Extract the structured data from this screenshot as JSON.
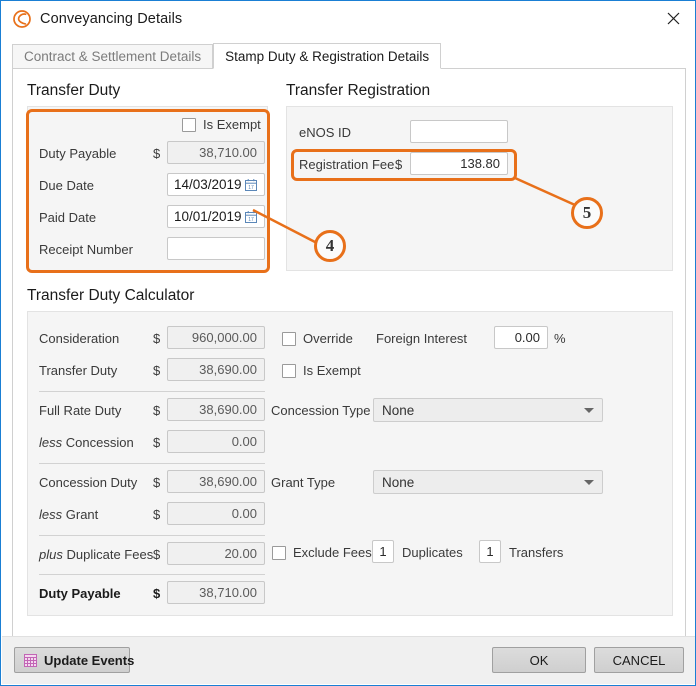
{
  "window": {
    "title": "Conveyancing Details",
    "app_icon": "conveyancing-logo-icon",
    "close_icon": "close-icon"
  },
  "tabs": [
    {
      "label": "Contract & Settlement Details",
      "active": false
    },
    {
      "label": "Stamp Duty & Registration Details",
      "active": true
    }
  ],
  "transfer_duty": {
    "title": "Transfer Duty",
    "is_exempt_label": "Is Exempt",
    "is_exempt_checked": false,
    "rows": {
      "duty_payable_label": "Duty Payable",
      "duty_payable_currency": "$",
      "duty_payable_value": "38,710.00",
      "due_date_label": "Due Date",
      "due_date_value": "14/03/2019",
      "paid_date_label": "Paid Date",
      "paid_date_value": "10/01/2019",
      "receipt_number_label": "Receipt Number",
      "receipt_number_value": ""
    }
  },
  "transfer_registration": {
    "title": "Transfer Registration",
    "enos_id_label": "eNOS ID",
    "enos_id_value": "",
    "registration_fee_label": "Registration Fee",
    "registration_fee_currency": "$",
    "registration_fee_value": "138.80"
  },
  "calculator": {
    "title": "Transfer Duty Calculator",
    "left": {
      "consideration_label": "Consideration",
      "consideration_currency": "$",
      "consideration_value": "960,000.00",
      "transfer_duty_label": "Transfer Duty",
      "transfer_duty_currency": "$",
      "transfer_duty_value": "38,690.00",
      "full_rate_duty_label": "Full Rate Duty",
      "full_rate_duty_currency": "$",
      "full_rate_duty_value": "38,690.00",
      "less_concession_prefix": "less",
      "less_concession_label": "Concession",
      "less_concession_currency": "$",
      "less_concession_value": "0.00",
      "concession_duty_label": "Concession Duty",
      "concession_duty_currency": "$",
      "concession_duty_value": "38,690.00",
      "less_grant_prefix": "less",
      "less_grant_label": "Grant",
      "less_grant_currency": "$",
      "less_grant_value": "0.00",
      "plus_duplicate_prefix": "plus",
      "plus_duplicate_label": "Duplicate Fees",
      "plus_duplicate_currency": "$",
      "plus_duplicate_value": "20.00",
      "duty_payable_label": "Duty Payable",
      "duty_payable_currency": "$",
      "duty_payable_value": "38,710.00"
    },
    "right": {
      "override_label": "Override",
      "override_checked": false,
      "foreign_interest_label": "Foreign Interest",
      "foreign_interest_value": "0.00",
      "percent_symbol": "%",
      "is_exempt_label": "Is Exempt",
      "is_exempt_checked": false,
      "concession_type_label": "Concession Type",
      "concession_type_value": "None",
      "grant_type_label": "Grant Type",
      "grant_type_value": "None",
      "exclude_fees_label": "Exclude Fees",
      "exclude_fees_checked": false,
      "duplicates_value": "1",
      "duplicates_label": "Duplicates",
      "transfers_value": "1",
      "transfers_label": "Transfers"
    }
  },
  "annotations": {
    "callout_4": "4",
    "callout_5": "5",
    "highlight_color": "#e8701a"
  },
  "footer": {
    "update_events_label": "Update Events",
    "update_events_icon": "calendar-grid-icon",
    "ok_label": "OK",
    "cancel_label": "CANCEL"
  }
}
